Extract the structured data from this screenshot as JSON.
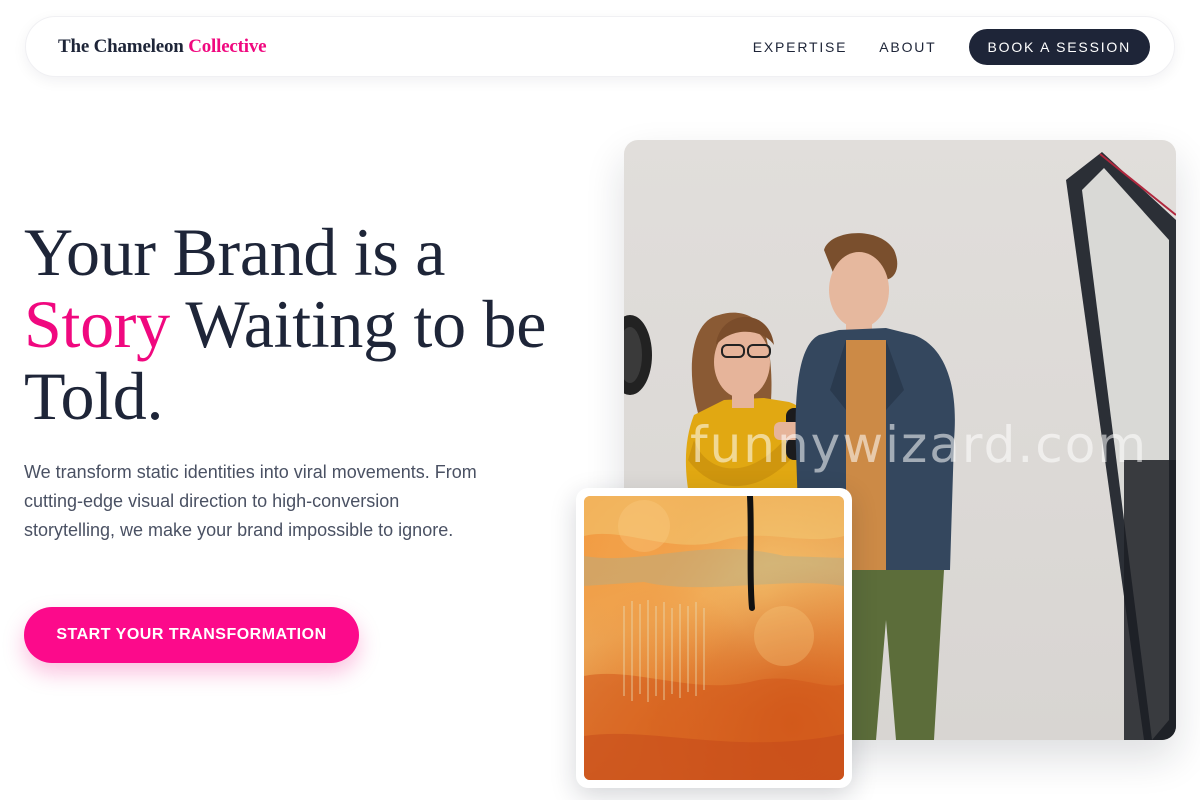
{
  "brand": {
    "name_main": "The Chameleon",
    "name_accent": "Collective"
  },
  "nav": {
    "links": [
      "EXPERTISE",
      "ABOUT"
    ],
    "cta": "BOOK A SESSION"
  },
  "hero": {
    "headline_part1": "Your Brand is a",
    "headline_highlight": "Story",
    "headline_part2": " Waiting to be Told.",
    "subtext": "We transform static identities into viral movements. From cutting-edge visual direction to high-conversion storytelling, we make your brand impossible to ignore.",
    "cta": "START YOUR TRANSFORMATION"
  },
  "images": {
    "main_photo": "photo-two-people-camera-studio",
    "art_card": "abstract-orange-textured-painting",
    "watermark": "funnywizard.com"
  },
  "colors": {
    "accent": "#f0087f",
    "cta": "#fc0a8b",
    "dark": "#1e2538",
    "body_text": "#4a5163"
  }
}
